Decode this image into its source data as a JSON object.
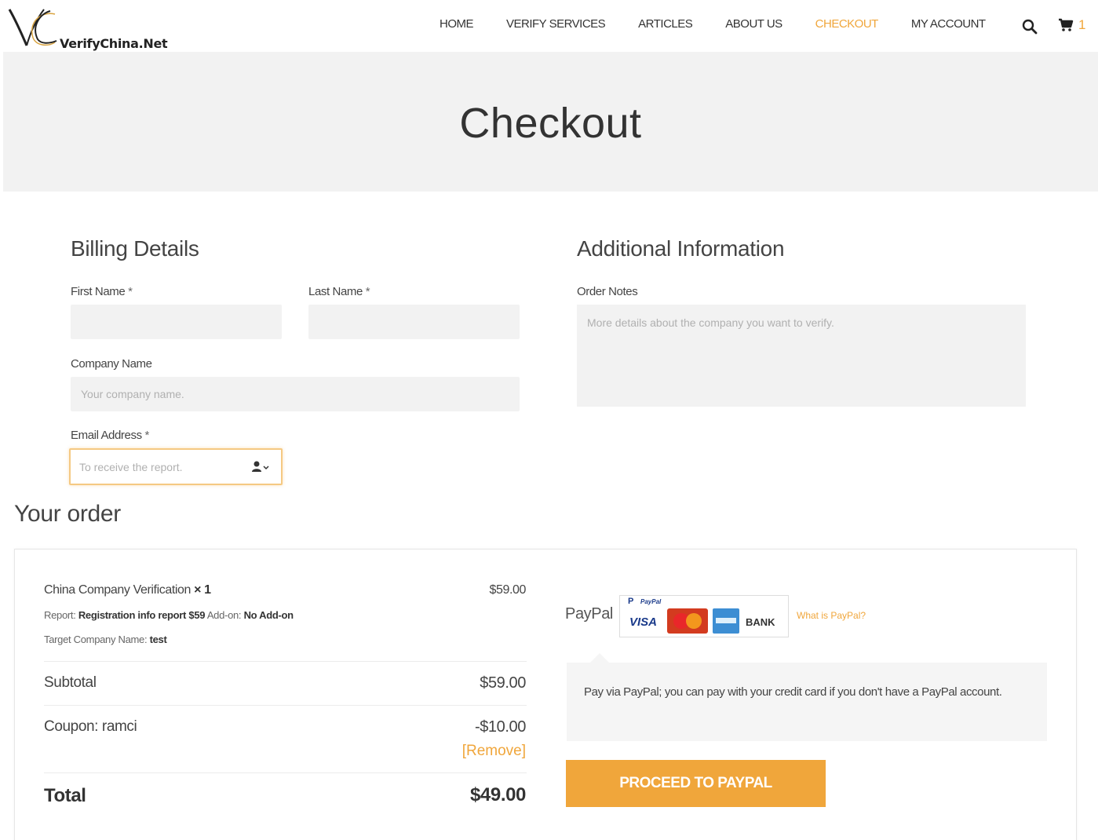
{
  "brand": {
    "name": "VerifyChina.Net"
  },
  "nav": {
    "items": [
      {
        "label": "HOME",
        "active": false
      },
      {
        "label": "VERIFY SERVICES",
        "active": false
      },
      {
        "label": "ARTICLES",
        "active": false
      },
      {
        "label": "ABOUT US",
        "active": false
      },
      {
        "label": "CHECKOUT",
        "active": true
      },
      {
        "label": "MY ACCOUNT",
        "active": false
      }
    ],
    "cart_count": "1",
    "accent_color": "#f0a63b"
  },
  "page": {
    "title": "Checkout"
  },
  "billing": {
    "title": "Billing Details",
    "first_name": {
      "label": "First Name",
      "required": "*",
      "value": "",
      "placeholder": ""
    },
    "last_name": {
      "label": "Last Name",
      "required": "*",
      "value": "",
      "placeholder": ""
    },
    "company_name": {
      "label": "Company Name",
      "value": "",
      "placeholder": "Your company name."
    },
    "email": {
      "label": "Email Address",
      "required": "*",
      "value": "",
      "placeholder": "To receive the report."
    }
  },
  "additional": {
    "title": "Additional Information",
    "order_notes": {
      "label": "Order Notes",
      "value": "",
      "placeholder": "More details about the company you want to verify."
    }
  },
  "order": {
    "title": "Your order",
    "item": {
      "name": "China Company Verification",
      "qty": "× 1",
      "price": "$59.00",
      "report_label": "Report:",
      "report_value": "Registration info report $59",
      "addon_label": "Add-on:",
      "addon_value": "No Add-on",
      "target_label": "Target Company Name:",
      "target_value": "test"
    },
    "subtotal": {
      "label": "Subtotal",
      "value": "$59.00"
    },
    "coupon": {
      "label": "Coupon: ramci",
      "value": "-$10.00",
      "remove": "[Remove]"
    },
    "total": {
      "label": "Total",
      "value": "$49.00"
    }
  },
  "payment": {
    "method": "PayPal",
    "what_is": "What is PayPal?",
    "card_badges": [
      "VISA",
      "BANK"
    ],
    "paypal_badge": "PayPal",
    "description": "Pay via PayPal; you can pay with your credit card if you don't have a PayPal account.",
    "button": "PROCEED TO PAYPAL"
  }
}
